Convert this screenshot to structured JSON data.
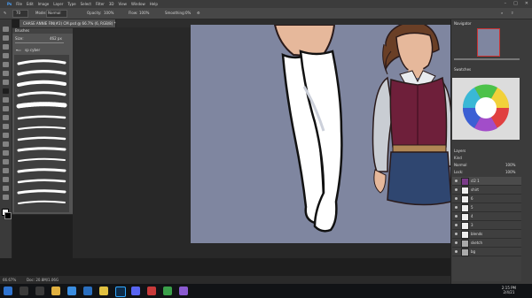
{
  "menubar": {
    "app_icon": "Ps",
    "items": [
      "File",
      "Edit",
      "Image",
      "Layer",
      "Type",
      "Select",
      "Filter",
      "3D",
      "View",
      "Window",
      "Help"
    ],
    "window_controls": [
      "–",
      "□",
      "✕"
    ]
  },
  "options": {
    "brush_size": "70",
    "mode_label": "Mode:",
    "mode_value": "Normal",
    "opacity_label": "Opacity:",
    "opacity_value": "100%",
    "flow_label": "Flow:",
    "flow_value": "100%",
    "smoothing_label": "Smoothing:",
    "smoothing_value": "0%"
  },
  "document_tab": {
    "title": "CHASE ANNIE FIN(#2) CM.psd @ 66.7% (6, RGB/8) *"
  },
  "brushes_panel": {
    "title": "Brushes",
    "size_label": "Size:",
    "size_value": "462 px",
    "folder_label": "sp cyber"
  },
  "navigator": {
    "title": "Navigator"
  },
  "swatches": {
    "title": "Swatches"
  },
  "layers_panel": {
    "title": "Layers",
    "kind_label": "Kind",
    "blend_mode": "Normal",
    "opacity": "100%",
    "lock_label": "Lock:",
    "fill": "100%",
    "layers": [
      {
        "name": "cl2 1",
        "thumb": "#7a3b88"
      },
      {
        "name": "shirt",
        "thumb": "#ffffff"
      },
      {
        "name": "6",
        "thumb": "#ffffff"
      },
      {
        "name": "5",
        "thumb": "#ffffff"
      },
      {
        "name": "4",
        "thumb": "#ffffff"
      },
      {
        "name": "3",
        "thumb": "#ffffff"
      },
      {
        "name": "blends",
        "thumb": "#ffffff"
      },
      {
        "name": "sketch",
        "thumb": "#ffffff"
      },
      {
        "name": "bg",
        "thumb": "#ffffff"
      }
    ]
  },
  "status": {
    "zoom": "66.67%",
    "doc": "Doc: 20.8M/1.06G"
  },
  "taskbar": {
    "time": "2:15 PM",
    "date": "2/4/21"
  },
  "colors": {
    "canvas_bg": "#7f86a0",
    "vest": "#6e1f3a",
    "skirt": "#2f4670",
    "shirt": "#c9cdd3"
  }
}
